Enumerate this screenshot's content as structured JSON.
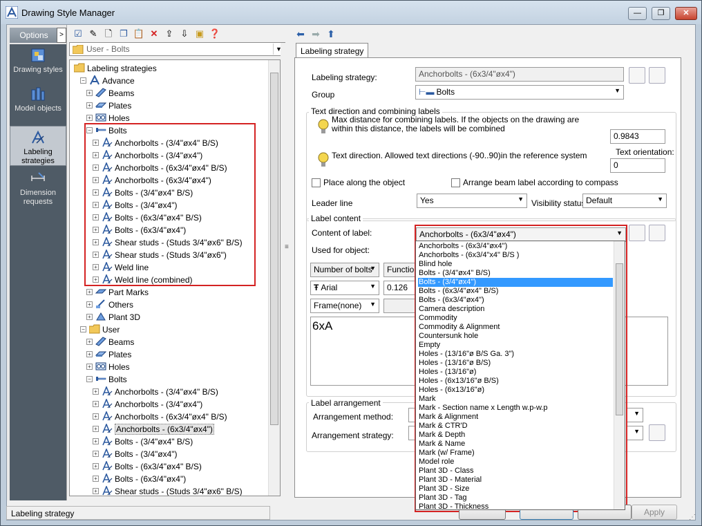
{
  "window": {
    "title": "Drawing Style Manager"
  },
  "options": {
    "header": "Options",
    "items": [
      {
        "label": "Drawing styles"
      },
      {
        "label": "Model objects"
      },
      {
        "label": "Labeling strategies"
      },
      {
        "label": "Dimension requests"
      }
    ]
  },
  "left": {
    "combo_value": "User - Bolts",
    "tree": [
      "Labeling strategies",
      "Advance",
      "Beams",
      "Plates",
      "Holes",
      "Bolts",
      "Anchorbolts - (3/4\"øx4\" B/S)",
      "Anchorbolts - (3/4\"øx4\")",
      "Anchorbolts - (6x3/4\"øx4\" B/S)",
      "Anchorbolts - (6x3/4\"øx4\")",
      "Bolts - (3/4\"øx4\" B/S)",
      "Bolts - (3/4\"øx4\")",
      "Bolts - (6x3/4\"øx4\" B/S)",
      "Bolts - (6x3/4\"øx4\")",
      "Shear studs - (Studs 3/4\"øx6\" B/S)",
      "Shear studs - (Studs 3/4\"øx6\")",
      "Weld line",
      "Weld line (combined)",
      "Part Marks",
      "Others",
      "Plant 3D",
      "User",
      "Beams",
      "Plates",
      "Holes",
      "Bolts",
      "Anchorbolts - (3/4\"øx4\" B/S)",
      "Anchorbolts - (3/4\"øx4\")",
      "Anchorbolts - (6x3/4\"øx4\" B/S)",
      "Anchorbolts - (6x3/4\"øx4\")",
      "Bolts - (3/4\"øx4\" B/S)",
      "Bolts - (3/4\"øx4\")",
      "Bolts - (6x3/4\"øx4\" B/S)",
      "Bolts - (6x3/4\"øx4\")",
      "Shear studs - (Studs 3/4\"øx6\" B/S)"
    ]
  },
  "right": {
    "tab": "Labeling strategy",
    "labeling_strategy_label": "Labeling strategy:",
    "labeling_strategy_value": "Anchorbolts - (6x3/4\"øx4\")",
    "group_label": "Group",
    "group_value": "Bolts",
    "text_dir_group": "Text direction and combining labels",
    "max_distance_text": "Max distance for combining labels. If the objects on the drawing are within this distance, the labels will be combined",
    "max_distance_value": "0.9843",
    "text_direction_text": "Text direction. Allowed text directions (-90..90)in the reference system",
    "text_orientation_label": "Text orientation:",
    "text_orientation_value": "0",
    "place_along": "Place along the object",
    "arrange_compass": "Arrange beam label according to compass",
    "leader_line_label": "Leader line",
    "leader_line_value": "Yes",
    "visibility_label": "Visibility status",
    "visibility_value": "Default",
    "label_content_group": "Label content",
    "content_label": "Content of label:",
    "content_value": "Anchorbolts - (6x3/4\"øx4\")",
    "used_for_label": "Used for object:",
    "number_of_bolts": "Number of bolts",
    "function_label": "Function",
    "font_value": "Arial",
    "font_size": "0.126",
    "frame_value": "Frame(none)",
    "text_preview": "6xA",
    "arrangement_group": "Label arrangement",
    "arrangement_method": "Arrangement method:",
    "arrangement_strategy": "Arrangement strategy:",
    "apply": "Apply"
  },
  "dropdown": {
    "selected_index": 4,
    "items": [
      "Anchorbolts - (6x3/4\"øx4\")",
      "Anchorbolts - (6x3/4\"x4\" B/S )",
      "Blind hole",
      "Bolts - (3/4\"øx4\" B/S)",
      "Bolts - (3/4\"øx4\")",
      "Bolts - (6x3/4\"øx4\" B/S)",
      "Bolts - (6x3/4\"øx4\")",
      "Camera description",
      "Commodity",
      "Commodity & Alignment",
      "Countersunk hole",
      "Empty",
      "Holes - (13/16\"ø B/S Ga. 3\")",
      "Holes - (13/16\"ø B/S)",
      "Holes - (13/16\"ø)",
      "Holes - (6x13/16\"ø B/S)",
      "Holes - (6x13/16\"ø)",
      "Mark",
      "Mark - Section name x Length w.p-w.p",
      "Mark & Alignment",
      "Mark & CTR'D",
      "Mark & Depth",
      "Mark & Name",
      "Mark (w/ Frame)",
      "Model role",
      "Plant 3D - Class",
      "Plant 3D - Material",
      "Plant 3D - Size",
      "Plant 3D - Tag",
      "Plant 3D - Thickness"
    ]
  },
  "status": {
    "text": "Labeling strategy"
  },
  "colors": {
    "highlight": "#3399ff",
    "annotation_red": "#d42222"
  }
}
